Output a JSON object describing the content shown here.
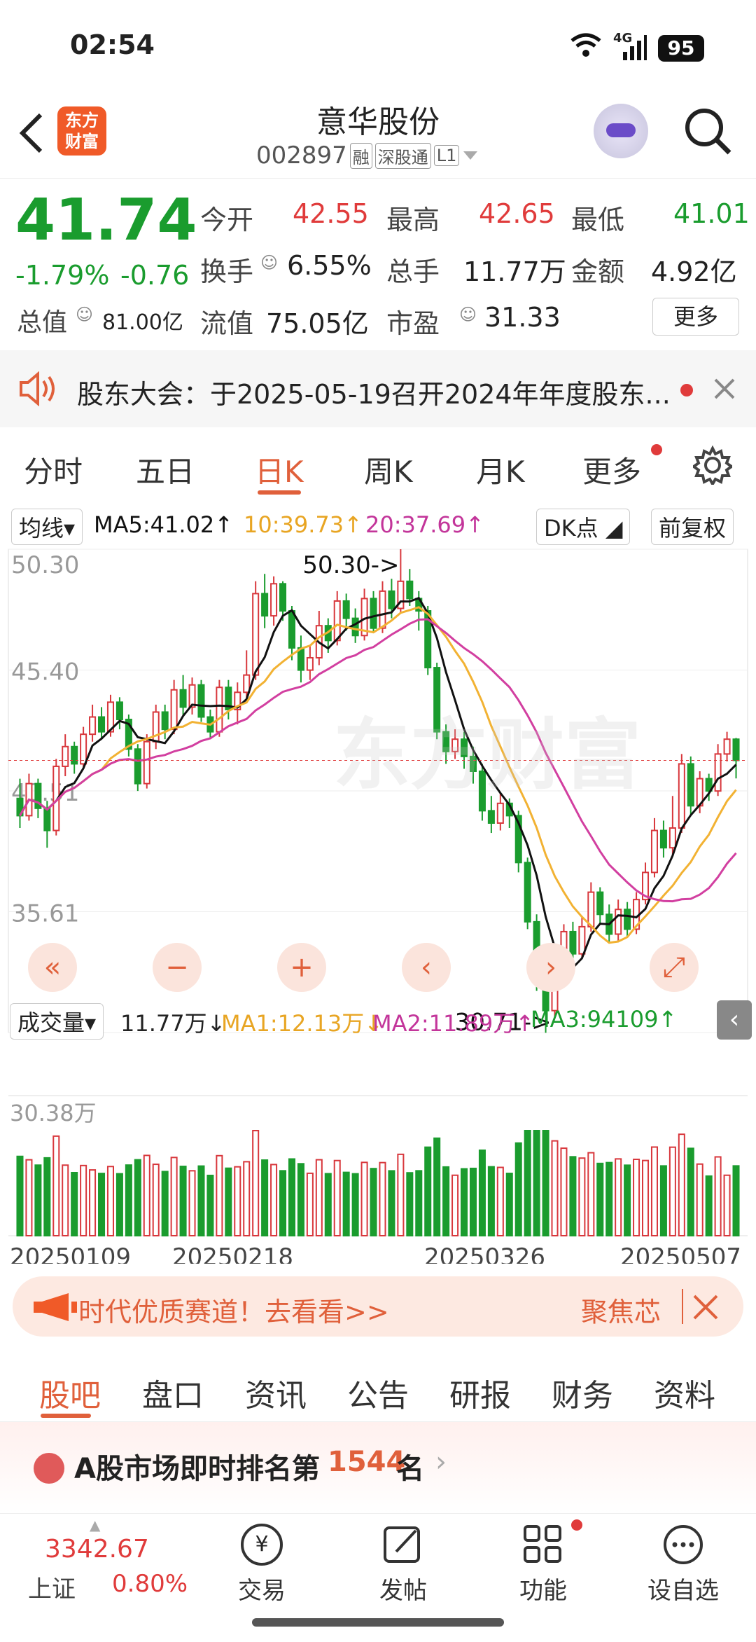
{
  "status": {
    "time": "02:54",
    "network": "4G",
    "battery": "95"
  },
  "header": {
    "logo": "东方\n财富",
    "title": "意华股份",
    "code": "002897",
    "tags": [
      "融",
      "深股通",
      "L1"
    ]
  },
  "quote": {
    "price": "41.74",
    "pct": "-1.79%",
    "chg": "-0.76",
    "items": [
      {
        "label": "今开",
        "value": "42.55"
      },
      {
        "label": "最高",
        "value": "42.65"
      },
      {
        "label": "最低",
        "value": "41.01"
      },
      {
        "label": "换手",
        "value": "6.55%"
      },
      {
        "label": "总手",
        "value": "11.77万"
      },
      {
        "label": "金额",
        "value": "4.92亿"
      },
      {
        "label": "总值",
        "value": "81.00亿"
      },
      {
        "label": "流值",
        "value": "75.05亿"
      },
      {
        "label": "市盈",
        "value": "31.33"
      }
    ],
    "more": "更多"
  },
  "notice": {
    "text": "股东大会：于2025-05-19召开2024年年度股东..."
  },
  "ktabs": {
    "items": [
      "分时",
      "五日",
      "日K",
      "周K",
      "月K",
      "更多"
    ],
    "active": "日K"
  },
  "chart": {
    "ma_label": "均线",
    "ma5": "MA5:41.02↑",
    "ma10": "10:39.73↑",
    "ma20": "20:37.69↑",
    "dk": "DK点",
    "fq": "前复权",
    "watermark": "东方财富",
    "high_mark": "50.30->",
    "low_mark": "30.71->",
    "vol_label": "成交量",
    "vol": "11.77万↓",
    "vma1": "MA1:12.13万↓",
    "vma2": "MA2:11.89万↑",
    "vma3": "MA3:94109↑",
    "vol_max": "30.38万",
    "colors": {
      "up": "#d8373c",
      "down": "#1a9c2e",
      "ma5": "#111111",
      "ma10": "#f2b233",
      "ma20": "#d23fa0"
    }
  },
  "chart_data": {
    "type": "candlestick",
    "y_ticks": [
      "50.30",
      "45.40",
      "40.51",
      "35.61",
      "30.71"
    ],
    "ylim": [
      30.71,
      50.3
    ],
    "x_ticks": [
      "20250109",
      "20250218",
      "20250326",
      "20250507"
    ],
    "candles": [
      [
        40.2,
        39.5,
        41.0,
        39.0
      ],
      [
        39.5,
        40.8,
        41.2,
        39.3
      ],
      [
        40.8,
        39.8,
        41.0,
        39.4
      ],
      [
        39.8,
        38.9,
        40.1,
        38.2
      ],
      [
        38.9,
        41.5,
        41.8,
        38.7
      ],
      [
        41.5,
        42.3,
        42.8,
        41.1
      ],
      [
        42.3,
        41.6,
        42.5,
        41.2
      ],
      [
        41.6,
        42.8,
        43.1,
        41.4
      ],
      [
        42.8,
        43.5,
        44.0,
        42.5
      ],
      [
        43.5,
        42.9,
        43.9,
        42.6
      ],
      [
        42.9,
        44.1,
        44.4,
        42.7
      ],
      [
        44.1,
        43.4,
        44.3,
        43.0
      ],
      [
        43.4,
        42.2,
        43.6,
        41.9
      ],
      [
        42.2,
        40.8,
        42.4,
        40.5
      ],
      [
        40.8,
        42.5,
        42.8,
        40.6
      ],
      [
        42.5,
        43.7,
        44.0,
        42.2
      ],
      [
        43.7,
        43.0,
        44.0,
        42.6
      ],
      [
        43.0,
        44.6,
        45.0,
        42.8
      ],
      [
        44.6,
        43.9,
        45.2,
        43.5
      ],
      [
        43.9,
        44.8,
        45.1,
        43.6
      ],
      [
        44.8,
        43.5,
        45.0,
        43.3
      ],
      [
        43.5,
        42.9,
        43.8,
        42.6
      ],
      [
        42.9,
        44.7,
        45.0,
        42.7
      ],
      [
        44.7,
        43.8,
        45.0,
        43.4
      ],
      [
        43.8,
        44.5,
        44.9,
        43.2
      ],
      [
        44.5,
        45.2,
        46.2,
        44.2
      ],
      [
        45.2,
        48.5,
        49.0,
        45.0
      ],
      [
        48.5,
        47.6,
        49.3,
        47.1
      ],
      [
        47.6,
        48.9,
        49.2,
        47.2
      ],
      [
        48.9,
        47.8,
        49.0,
        47.4
      ],
      [
        47.8,
        46.3,
        48.0,
        45.8
      ],
      [
        46.3,
        45.4,
        46.8,
        44.9
      ],
      [
        45.4,
        45.9,
        46.4,
        45.0
      ],
      [
        45.9,
        47.2,
        47.8,
        45.6
      ],
      [
        47.2,
        46.6,
        47.5,
        46.1
      ],
      [
        46.6,
        48.2,
        48.6,
        46.4
      ],
      [
        48.2,
        47.5,
        48.5,
        47.0
      ],
      [
        47.5,
        46.8,
        47.9,
        46.5
      ],
      [
        46.8,
        48.3,
        48.7,
        46.6
      ],
      [
        48.3,
        47.1,
        48.6,
        46.9
      ],
      [
        47.1,
        48.6,
        49.0,
        46.9
      ],
      [
        48.6,
        47.9,
        49.1,
        47.5
      ],
      [
        47.9,
        49.0,
        50.3,
        47.7
      ],
      [
        49.0,
        48.3,
        49.5,
        48.0
      ],
      [
        48.3,
        47.8,
        48.6,
        47.0
      ],
      [
        47.8,
        45.5,
        48.0,
        45.2
      ],
      [
        45.5,
        42.9,
        45.7,
        42.6
      ],
      [
        42.9,
        42.1,
        43.2,
        41.6
      ],
      [
        42.1,
        42.6,
        43.0,
        41.8
      ],
      [
        42.6,
        41.9,
        42.9,
        41.4
      ],
      [
        41.9,
        41.3,
        42.3,
        40.8
      ],
      [
        41.3,
        39.7,
        41.6,
        39.3
      ],
      [
        39.7,
        39.2,
        40.3,
        38.8
      ],
      [
        39.2,
        40.0,
        40.4,
        38.9
      ],
      [
        40.0,
        39.5,
        40.2,
        39.0
      ],
      [
        39.5,
        37.6,
        39.7,
        37.2
      ],
      [
        37.6,
        35.2,
        37.8,
        34.9
      ],
      [
        35.2,
        33.1,
        35.5,
        32.4
      ],
      [
        33.1,
        31.6,
        33.4,
        30.7
      ],
      [
        31.6,
        33.3,
        33.6,
        31.3
      ],
      [
        33.3,
        34.8,
        35.1,
        33.0
      ],
      [
        34.8,
        33.9,
        35.2,
        33.5
      ],
      [
        33.9,
        35.0,
        35.4,
        33.7
      ],
      [
        35.0,
        36.4,
        36.8,
        34.8
      ],
      [
        36.4,
        35.5,
        36.6,
        35.1
      ],
      [
        35.5,
        34.7,
        35.9,
        34.4
      ],
      [
        34.7,
        35.7,
        36.1,
        34.4
      ],
      [
        35.7,
        34.9,
        36.0,
        34.6
      ],
      [
        34.9,
        36.1,
        36.4,
        34.7
      ],
      [
        36.1,
        37.2,
        37.6,
        35.9
      ],
      [
        37.2,
        38.9,
        39.4,
        37.0
      ],
      [
        38.9,
        38.2,
        39.3,
        37.8
      ],
      [
        38.2,
        39.0,
        40.3,
        37.9
      ],
      [
        39.0,
        41.6,
        42.0,
        38.8
      ],
      [
        41.6,
        39.9,
        41.9,
        39.5
      ],
      [
        39.9,
        41.0,
        41.3,
        39.6
      ],
      [
        41.0,
        40.5,
        41.2,
        40.1
      ],
      [
        40.5,
        42.0,
        42.4,
        40.3
      ],
      [
        42.0,
        42.6,
        42.9,
        41.7
      ],
      [
        42.6,
        41.74,
        42.65,
        41.01
      ]
    ]
  },
  "banner": {
    "text": "时代优质赛道！去看看>>",
    "tag": "聚焦芯"
  },
  "subtabs": {
    "items": [
      "股吧",
      "盘口",
      "资讯",
      "公告",
      "研报",
      "财务",
      "资料"
    ],
    "active": "股吧"
  },
  "rank": {
    "prefix": "A股市场即时排名第",
    "num": "1544",
    "suffix": "名"
  },
  "bottom": {
    "index_val": "3342.67",
    "index_name": "上证",
    "index_pct": "0.80%",
    "items": [
      "交易",
      "发帖",
      "功能",
      "设自选"
    ]
  }
}
